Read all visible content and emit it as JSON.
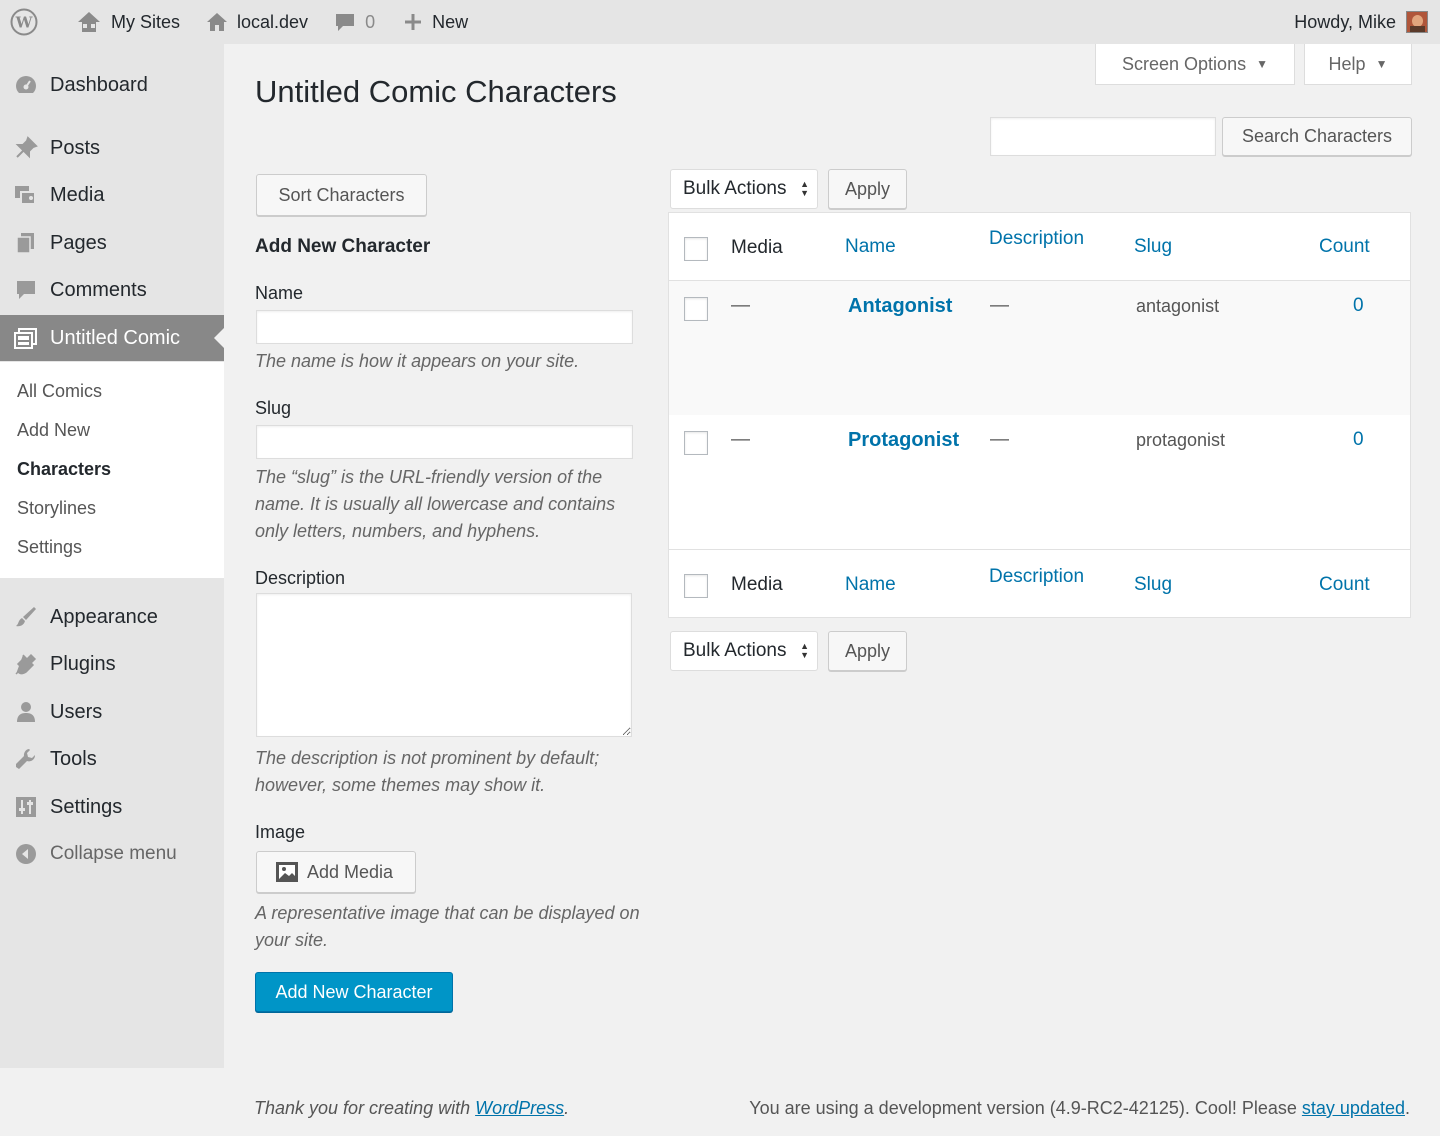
{
  "adminbar": {
    "my_sites": "My Sites",
    "site_name": "local.dev",
    "comments_count": "0",
    "new_label": "New",
    "howdy": "Howdy, Mike"
  },
  "sidebar": {
    "items": [
      {
        "label": "Dashboard",
        "icon": "dashboard-icon"
      },
      {
        "label": "Posts",
        "icon": "pushpin-icon"
      },
      {
        "label": "Media",
        "icon": "media-icon"
      },
      {
        "label": "Pages",
        "icon": "pages-icon"
      },
      {
        "label": "Comments",
        "icon": "comment-icon"
      },
      {
        "label": "Untitled Comic",
        "icon": "comic-icon"
      },
      {
        "label": "Appearance",
        "icon": "paintbrush-icon"
      },
      {
        "label": "Plugins",
        "icon": "plugin-icon"
      },
      {
        "label": "Users",
        "icon": "user-icon"
      },
      {
        "label": "Tools",
        "icon": "wrench-icon"
      },
      {
        "label": "Settings",
        "icon": "sliders-icon"
      },
      {
        "label": "Collapse menu",
        "icon": "collapse-icon"
      }
    ],
    "submenu": [
      "All Comics",
      "Add New",
      "Characters",
      "Storylines",
      "Settings"
    ]
  },
  "header": {
    "screen_options": "Screen Options",
    "help": "Help",
    "title": "Untitled Comic Characters",
    "search_button": "Search Characters",
    "search_value": ""
  },
  "form": {
    "sort_button": "Sort Characters",
    "heading": "Add New Character",
    "name_label": "Name",
    "name_help": "The name is how it appears on your site.",
    "slug_label": "Slug",
    "slug_help": "The “slug” is the URL-friendly version of the name. It is usually all lowercase and contains only letters, numbers, and hyphens.",
    "description_label": "Description",
    "description_help": "The description is not prominent by default; however, some themes may show it.",
    "image_label": "Image",
    "add_media": "Add Media",
    "image_help": "A representative image that can be displayed on your site.",
    "submit": "Add New Character"
  },
  "table": {
    "bulk_actions": "Bulk Actions",
    "apply": "Apply",
    "columns": [
      "Media",
      "Name",
      "Description",
      "Slug",
      "Count"
    ],
    "rows": [
      {
        "media": "—",
        "name": "Antagonist",
        "description": "—",
        "slug": "antagonist",
        "count": "0"
      },
      {
        "media": "—",
        "name": "Protagonist",
        "description": "—",
        "slug": "protagonist",
        "count": "0"
      }
    ]
  },
  "footer": {
    "thanks_prefix": "Thank you for creating with ",
    "thanks_link": "WordPress",
    "thanks_suffix": ".",
    "version_text": "You are using a development version (4.9-RC2-42125). Cool! Please ",
    "version_link": "stay updated",
    "version_suffix": "."
  },
  "colors": {
    "link": "#0073aa",
    "primary_button": "#0095c7",
    "sidebar_current": "#888888"
  }
}
